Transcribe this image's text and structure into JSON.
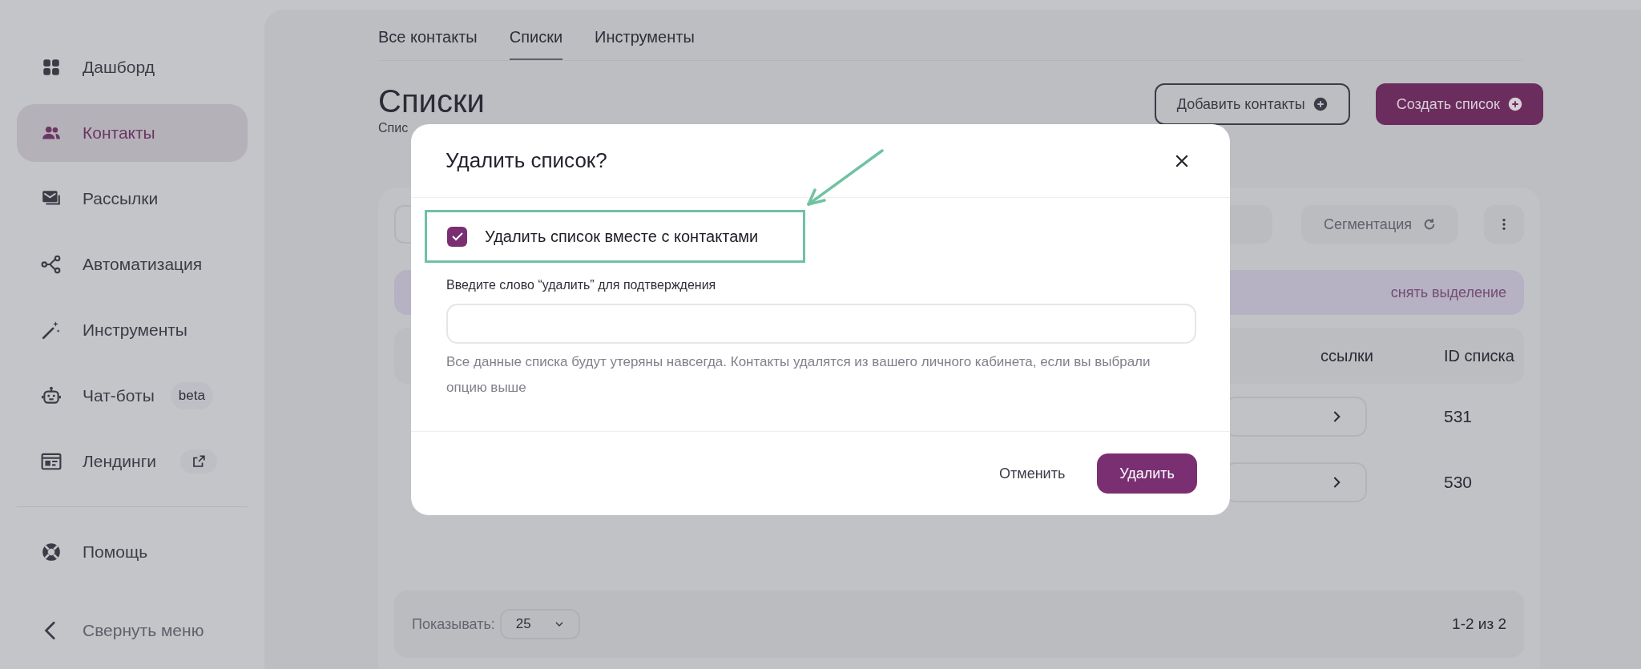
{
  "sidebar": {
    "items": [
      {
        "label": "Дашборд",
        "selected": false
      },
      {
        "label": "Контакты",
        "selected": true
      },
      {
        "label": "Рассылки",
        "selected": false
      },
      {
        "label": "Автоматизация",
        "selected": false
      },
      {
        "label": "Инструменты",
        "selected": false
      },
      {
        "label": "Чат-боты",
        "selected": false,
        "badge": "beta"
      },
      {
        "label": "Лендинги",
        "selected": false,
        "external": true
      }
    ],
    "footer_items": [
      {
        "label": "Помощь"
      },
      {
        "label": "Свернуть меню"
      }
    ]
  },
  "tabs": [
    {
      "label": "Все контакты",
      "selected": false
    },
    {
      "label": "Списки",
      "selected": true
    },
    {
      "label": "Инструменты",
      "selected": false
    }
  ],
  "page": {
    "title": "Списки",
    "subtitle": "Спис",
    "buttons": [
      {
        "label": "Добавить контакты",
        "kind": "outline"
      },
      {
        "label": "Создать список",
        "kind": "primary"
      }
    ]
  },
  "toolbar": {
    "segmentation": "Сегментация"
  },
  "selection_bar": {
    "clear": "снять выделение"
  },
  "table": {
    "columns": [
      "ссылки",
      "ID списка"
    ],
    "rows": [
      {
        "id": "531"
      },
      {
        "id": "530"
      }
    ]
  },
  "pagination": {
    "label": "Показывать:",
    "per_page": "25",
    "range": "1-2 из 2"
  },
  "dialog": {
    "title": "Удалить список?",
    "checkbox": {
      "label": "Удалить список вместе с контактами",
      "checked": true
    },
    "field": {
      "label": "Введите слово “удалить” для подтверждения"
    },
    "hint": "Все данные списка будут утеряны навсегда. Контакты удалятся из вашего личного кабинета, если вы выбрали опцию выше",
    "buttons": [
      {
        "label": "Отменить",
        "kind": "text"
      },
      {
        "label": "Удалить",
        "kind": "primary"
      }
    ]
  }
}
